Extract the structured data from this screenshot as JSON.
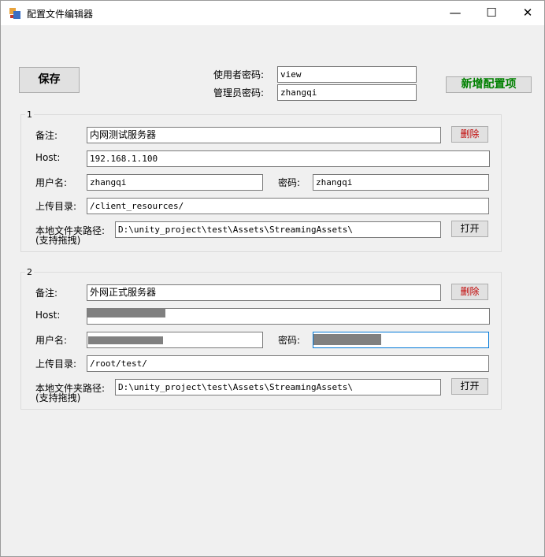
{
  "window": {
    "title": "配置文件编辑器",
    "min_glyph": "—",
    "max_glyph": "☐",
    "close_glyph": "✕"
  },
  "toolbar": {
    "save_label": "保存",
    "user_password_label": "使用者密码:",
    "user_password_value": "view",
    "admin_password_label": "管理员密码:",
    "admin_password_value": "zhangqi",
    "add_config_label": "新增配置项"
  },
  "configs": [
    {
      "index": "1",
      "note_label": "备注:",
      "note_value": "内网测试服务器",
      "delete_label": "删除",
      "host_label": "Host:",
      "host_value": "192.168.1.100",
      "user_label": "用户名:",
      "user_value": "zhangqi",
      "password_label": "密码:",
      "password_value": "zhangqi",
      "upload_label": "上传目录:",
      "upload_value": "/client_resources/",
      "local_label_line1": "本地文件夹路径:",
      "local_label_line2": "(支持拖拽)",
      "local_value": "D:\\unity_project\\test\\Assets\\StreamingAssets\\",
      "open_label": "打开"
    },
    {
      "index": "2",
      "note_label": "备注:",
      "note_value": "外网正式服务器",
      "delete_label": "删除",
      "host_label": "Host:",
      "host_value": "",
      "user_label": "用户名:",
      "user_value": "",
      "password_label": "密码:",
      "password_value": "",
      "upload_label": "上传目录:",
      "upload_value": "/root/test/",
      "local_label_line1": "本地文件夹路径:",
      "local_label_line2": "(支持拖拽)",
      "local_value": "D:\\unity_project\\test\\Assets\\StreamingAssets\\",
      "open_label": "打开"
    }
  ]
}
